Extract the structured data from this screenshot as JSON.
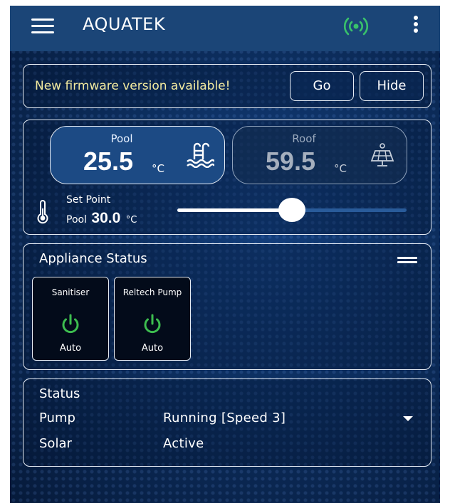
{
  "app": {
    "title": "AQUATEK"
  },
  "icons": {
    "menu": "menu-icon",
    "connection": "wifi-signal-icon",
    "more": "more-vert-icon",
    "pool": "swimming-pool-icon",
    "roof": "solar-panel-icon",
    "thermometer": "thermometer-icon",
    "power": "power-icon"
  },
  "colors": {
    "background": "#0b2a57",
    "app_bar": "#1b4577",
    "connection_green": "#39c26b",
    "firmware_text": "#f3eba0",
    "power_green": "#3dbd4f"
  },
  "firmware": {
    "message": "New firmware version available!",
    "go_label": "Go",
    "hide_label": "Hide"
  },
  "temperatures": {
    "pool": {
      "label": "Pool",
      "value": "25.5",
      "unit": "°C"
    },
    "roof": {
      "label": "Roof",
      "value": "59.5",
      "unit": "°C"
    }
  },
  "set_point": {
    "title": "Set Point",
    "target": "Pool",
    "value": "30.0",
    "unit": "°C",
    "slider_fraction": 0.5
  },
  "appliance_status": {
    "title": "Appliance Status",
    "appliances": [
      {
        "name": "Sanitiser",
        "mode": "Auto"
      },
      {
        "name": "Reltech Pump",
        "mode": "Auto"
      }
    ]
  },
  "status": {
    "title": "Status",
    "pump": {
      "label": "Pump",
      "value": "Running [Speed 3]"
    },
    "solar": {
      "label": "Solar",
      "value": "Active"
    }
  }
}
